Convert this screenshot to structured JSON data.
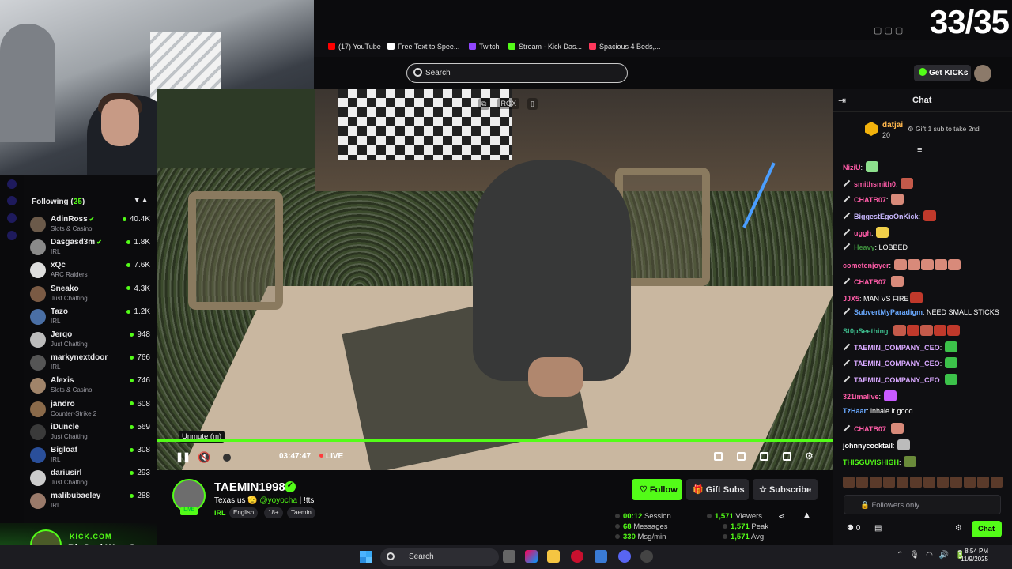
{
  "overlay": {
    "counter": "33/35",
    "kick_label": "KICK.COM",
    "kick_name": "BigSackWontSag"
  },
  "bookmarks": [
    {
      "label": "(17) YouTube",
      "color": "#ff0000"
    },
    {
      "label": "Free Text to Spee...",
      "color": "#ffffff"
    },
    {
      "label": "Twitch",
      "color": "#9146ff"
    },
    {
      "label": "Stream - Kick Das...",
      "color": "#53fc18"
    },
    {
      "label": "Spacious 4 Beds,...",
      "color": "#ff385c"
    }
  ],
  "header": {
    "search_placeholder": "Search",
    "get_kicks": "Get KICKs"
  },
  "following": {
    "title": "Following",
    "count": "25",
    "channels": [
      {
        "name": "AdinRoss",
        "category": "Slots & Casino",
        "viewers": "40.4K",
        "verified": true,
        "avatar": "#6b5a4a"
      },
      {
        "name": "Dasgasd3m",
        "category": "IRL",
        "viewers": "1.8K",
        "verified": true,
        "avatar": "#8a8a8a"
      },
      {
        "name": "xQc",
        "category": "ARC Raiders",
        "viewers": "7.6K",
        "verified": false,
        "avatar": "#dddddd"
      },
      {
        "name": "Sneako",
        "category": "Just Chatting",
        "viewers": "4.3K",
        "verified": false,
        "avatar": "#7a5a44"
      },
      {
        "name": "Tazo",
        "category": "IRL",
        "viewers": "1.2K",
        "verified": false,
        "avatar": "#4a6fa5"
      },
      {
        "name": "Jerqo",
        "category": "Just Chatting",
        "viewers": "948",
        "verified": false,
        "avatar": "#bcbcbc"
      },
      {
        "name": "markynextdoor",
        "category": "IRL",
        "viewers": "766",
        "verified": false,
        "avatar": "#555555"
      },
      {
        "name": "Alexis",
        "category": "Slots & Casino",
        "viewers": "746",
        "verified": false,
        "avatar": "#a0846a"
      },
      {
        "name": "jandro",
        "category": "Counter-Strike 2",
        "viewers": "608",
        "verified": false,
        "avatar": "#8a6a4a"
      },
      {
        "name": "iDuncle",
        "category": "Just Chatting",
        "viewers": "569",
        "verified": false,
        "avatar": "#3a3a3a"
      },
      {
        "name": "Bigloaf",
        "category": "IRL",
        "viewers": "308",
        "verified": false,
        "avatar": "#2a4f9a"
      },
      {
        "name": "dariusirl",
        "category": "Just Chatting",
        "viewers": "293",
        "verified": false,
        "avatar": "#cccccc"
      },
      {
        "name": "malibubaeley",
        "category": "IRL",
        "viewers": "288",
        "verified": false,
        "avatar": "#9a7a6a"
      }
    ]
  },
  "player": {
    "tooltip": "Unmute (m)",
    "time": "03:47:47",
    "live": "LIVE",
    "top_badges": [
      "RGX"
    ]
  },
  "streamer": {
    "name": "TAEMIN1998",
    "title_prefix": "Texas us 🫡",
    "mention": "@yoyocha",
    "title_suffix": "| !tts",
    "category": "IRL",
    "tags": [
      "English",
      "18+",
      "Taemin"
    ],
    "live_badge": "LIVE",
    "follow": "Follow",
    "gift_subs": "Gift Subs",
    "subscribe": "Subscribe"
  },
  "stats": {
    "session_value": "00:12",
    "session_label": "Session",
    "messages_value": "68",
    "messages_label": "Messages",
    "msgmin_value": "330",
    "msgmin_label": "Msg/min",
    "viewers_value": "1,571",
    "viewers_label": "Viewers",
    "peak_value": "1,571",
    "peak_label": "Peak",
    "avg_value": "1,571",
    "avg_label": "Avg"
  },
  "chat": {
    "title": "Chat",
    "pinned": {
      "user": "datjai",
      "amount": "20",
      "message": "Gift 1 sub to take 2nd"
    },
    "messages": [
      {
        "user": "NiziU",
        "color": "#ff5ca8",
        "text": "",
        "badge": false,
        "emotes": [
          "#8de08d"
        ]
      },
      {
        "user": "smithsmith0",
        "color": "#ff5ca8",
        "text": "",
        "badge": true,
        "emotes": [
          "#c45a4a"
        ]
      },
      {
        "user": "CHATB07",
        "color": "#ff5ca8",
        "text": "",
        "badge": true,
        "emotes": [
          "#d88a7a"
        ]
      },
      {
        "user": "BiggestEgoOnKick",
        "color": "#c9b8ff",
        "text": "",
        "badge": true,
        "emotes": [
          "#c0392b"
        ]
      },
      {
        "user": "uggh",
        "color": "#ff5ca8",
        "text": "",
        "badge": true,
        "emotes": [
          "#f1d04a"
        ]
      },
      {
        "user": "Heavy",
        "color": "#3c8c3c",
        "text": "LOBBED",
        "badge": true,
        "emotes": []
      },
      {
        "user": "cometenjoyer",
        "color": "#ff5ca8",
        "text": "",
        "badge": false,
        "emotes": [
          "#d88a7a",
          "#d88a7a",
          "#d88a7a",
          "#d88a7a",
          "#d88a7a"
        ]
      },
      {
        "user": "CHATB07",
        "color": "#ff5ca8",
        "text": "",
        "badge": true,
        "emotes": [
          "#d88a7a"
        ]
      },
      {
        "user": "JJX5",
        "color": "#ff5ca8",
        "text": "MAN VS FIRE",
        "badge": false,
        "emotes": [
          "#c0392b"
        ]
      },
      {
        "user": "SubvertMyParadigm",
        "color": "#6aa9ff",
        "text": "NEED SMALL STICKS",
        "badge": true,
        "emotes": []
      },
      {
        "user": "St0pSeething",
        "color": "#3cb88a",
        "text": "",
        "badge": false,
        "emotes": [
          "#c45a4a",
          "#c0392b",
          "#c45a4a",
          "#c0392b",
          "#c0392b"
        ]
      },
      {
        "user": "TAEMIN_COMPANY_CEO",
        "color": "#d8a8ff",
        "text": "",
        "badge": true,
        "emotes": [
          "#3cc24a"
        ]
      },
      {
        "user": "TAEMIN_COMPANY_CEO",
        "color": "#d8a8ff",
        "text": "",
        "badge": true,
        "emotes": [
          "#3cc24a"
        ]
      },
      {
        "user": "TAEMIN_COMPANY_CEO",
        "color": "#d8a8ff",
        "text": "",
        "badge": true,
        "emotes": [
          "#3cc24a"
        ]
      },
      {
        "user": "321imalive",
        "color": "#ff5ca8",
        "text": "",
        "badge": false,
        "emotes": [
          "#c85aff"
        ]
      },
      {
        "user": "TzHaar",
        "color": "#6aa9ff",
        "text": "inhale it good",
        "badge": false,
        "emotes": []
      },
      {
        "user": "CHATB07",
        "color": "#ff5ca8",
        "text": "",
        "badge": true,
        "emotes": [
          "#d88a7a"
        ]
      },
      {
        "user": "johnnycocktail",
        "color": "#ffffff",
        "text": "",
        "badge": false,
        "emotes": [
          "#bbbbbb"
        ]
      },
      {
        "user": "THISGUYISHIGH",
        "color": "#53fc18",
        "text": "",
        "badge": false,
        "emotes": [
          "#6a8a3a"
        ]
      }
    ],
    "input_placeholder": "Followers only",
    "kicks_count": "0",
    "chat_button": "Chat"
  },
  "taskbar": {
    "search": "Search",
    "time": "8:54 PM",
    "date": "11/9/2025"
  }
}
